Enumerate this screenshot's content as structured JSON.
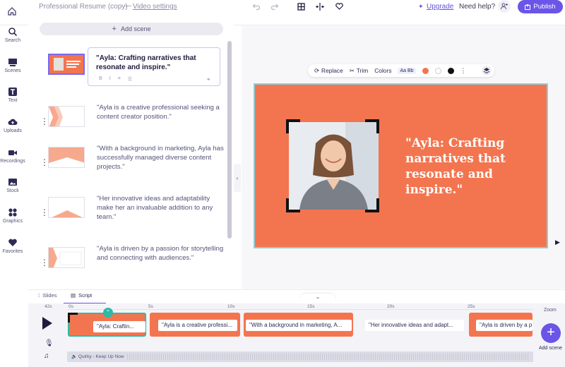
{
  "topbar": {
    "doc_title": "Professional Resume (copy)",
    "separator": "—",
    "video_settings": "Video settings",
    "upgrade": "Upgrade",
    "help": "Need help?",
    "publish": "Publish"
  },
  "nav": {
    "items": [
      {
        "label": "Search",
        "icon": "search-icon"
      },
      {
        "label": "Scenes",
        "icon": "scenes-icon"
      },
      {
        "label": "Text",
        "icon": "text-icon"
      },
      {
        "label": "Uploads",
        "icon": "upload-icon"
      },
      {
        "label": "Recordings",
        "icon": "camera-icon"
      },
      {
        "label": "Stock",
        "icon": "image-icon"
      },
      {
        "label": "Graphics",
        "icon": "shapes-icon"
      },
      {
        "label": "Favorites",
        "icon": "heart-icon"
      }
    ]
  },
  "scenes": {
    "add_label": "Add scene",
    "items": [
      {
        "text": "\"Ayla: Crafting narratives that resonate and inspire.\""
      },
      {
        "text": "\"Ayla is a creative professional seeking a content creator position.\""
      },
      {
        "text": "\"With a background in marketing, Ayla has successfully managed diverse content projects.\""
      },
      {
        "text": "\"Her innovative ideas and adaptability make her an invaluable addition to any team.\""
      },
      {
        "text": "\"Ayla is driven by a passion for storytelling and connecting with audiences.\""
      }
    ]
  },
  "toolbar": {
    "replace": "Replace",
    "trim": "Trim",
    "colors": "Colors",
    "font_sample": "Aa Bb",
    "color_1": "#f3754f",
    "color_2": "#ffffff",
    "color_3": "#111111"
  },
  "slide": {
    "quote": "\"Ayla: Crafting narratives that resonate and inspire.\"",
    "background": "#f3754f"
  },
  "tabs": {
    "slides": "Slides",
    "script": "Script"
  },
  "timeline": {
    "duration": "42s",
    "marks": [
      "0s",
      "5s",
      "10s",
      "15s",
      "20s",
      "25s"
    ],
    "clips": [
      "\"Ayla: Craftin...",
      "\"Ayla is a creative professi...",
      "\"With a background in marketing, A...",
      "\"Her innovative ideas and adapt...",
      "\"Ayla is driven by a p"
    ],
    "audio": "Quirky - Keep Up Now",
    "zoom": "Zoom",
    "add_scene": "Add scene"
  }
}
